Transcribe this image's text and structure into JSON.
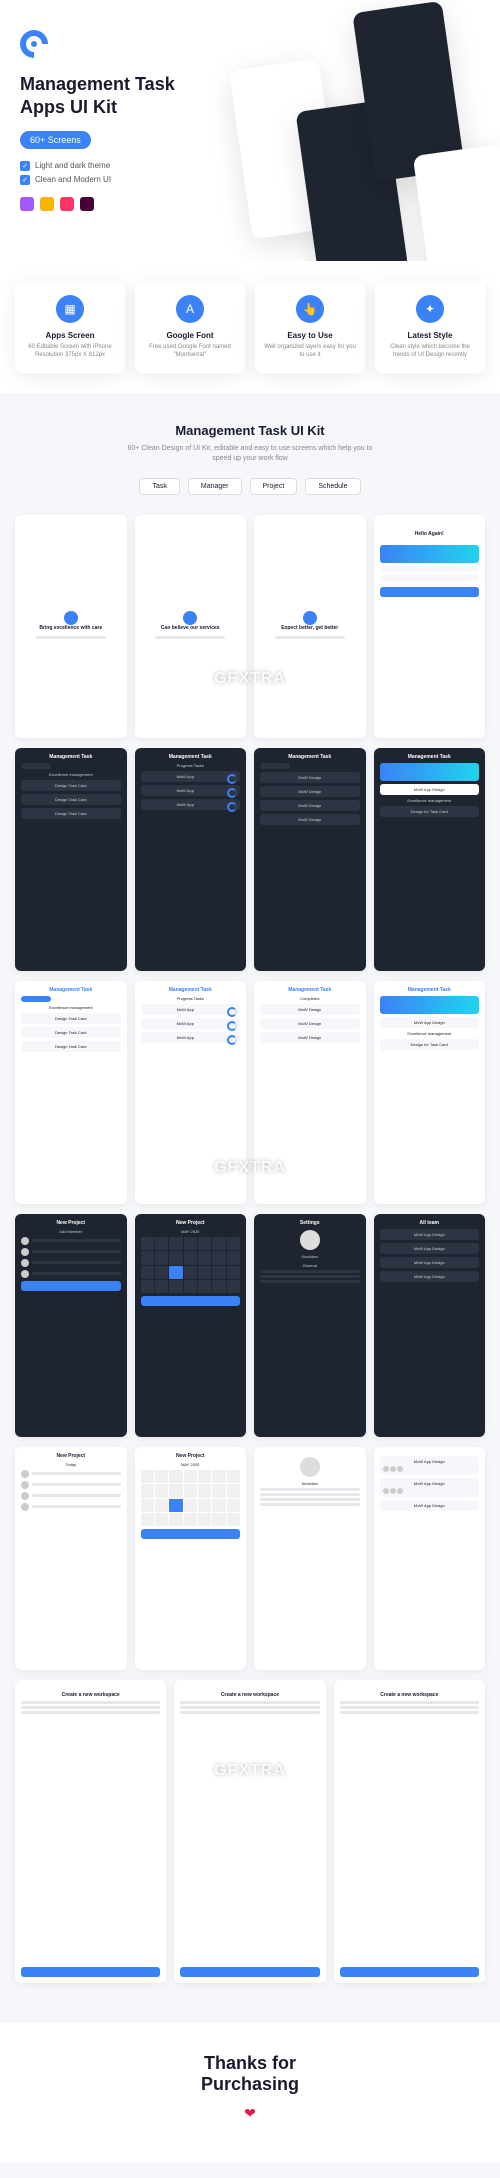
{
  "hero": {
    "title_line1": "Management Task",
    "title_line2": "Apps UI Kit",
    "badge": "60+ Screens",
    "check1": "Light and dark theme",
    "check2": "Clean and Modern UI",
    "tool_colors": [
      "#a259ff",
      "#f7b500",
      "#ff3366",
      "#470137"
    ]
  },
  "features": [
    {
      "icon": "▦",
      "title": "Apps Screen",
      "desc": "60 Editable Screen with iPhone Resolution 375px X 812px"
    },
    {
      "icon": "A",
      "title": "Google Font",
      "desc": "Free used Google Font named \"Montserrat\""
    },
    {
      "icon": "👆",
      "title": "Easy to Use",
      "desc": "Well organized layers easy for you to use it"
    },
    {
      "icon": "✦",
      "title": "Latest Style",
      "desc": "Clean style which become the trends of UI Design recently"
    }
  ],
  "section2": {
    "title": "Management Task UI Kit",
    "sub": "60+ Clean Design of UI Kit, editable and easy to use screens which help you to speed up your work flow",
    "tabs": [
      "Task",
      "Manager",
      "Project",
      "Schedule"
    ]
  },
  "onboard": [
    "Bring excellence with care",
    "Can believe our services",
    "Expect better, get better",
    "Hello Again!"
  ],
  "task_labels": {
    "header": "Management Task",
    "excellence": "Excellence management",
    "design_card": "Design Task Card",
    "design_for": "Design for Task Card",
    "progress": "Progress Tasks",
    "completed": "Completed",
    "mov": "MoW App",
    "mov_design": "MoW Design",
    "mov_app_design": "MoW App Design",
    "complete_pill": "Complete"
  },
  "darkrow2": {
    "new_project": "New Project",
    "add_member": "Add Member",
    "date": "MAY 2020",
    "settings": "Settings",
    "name": "Kicoldian",
    "general": "General",
    "alteam": "All team"
  },
  "lightrow3": {
    "new_project": "New Project",
    "today": "Today",
    "date": "MAY 2020",
    "name": "Kicoldian",
    "mov": "MoW App Design"
  },
  "workspace": {
    "title": "Create a new workspace"
  },
  "thanks": {
    "title": "Thanks for",
    "title2": "Purchasing",
    "heart": "❤"
  },
  "watermark": "GFXTRA"
}
